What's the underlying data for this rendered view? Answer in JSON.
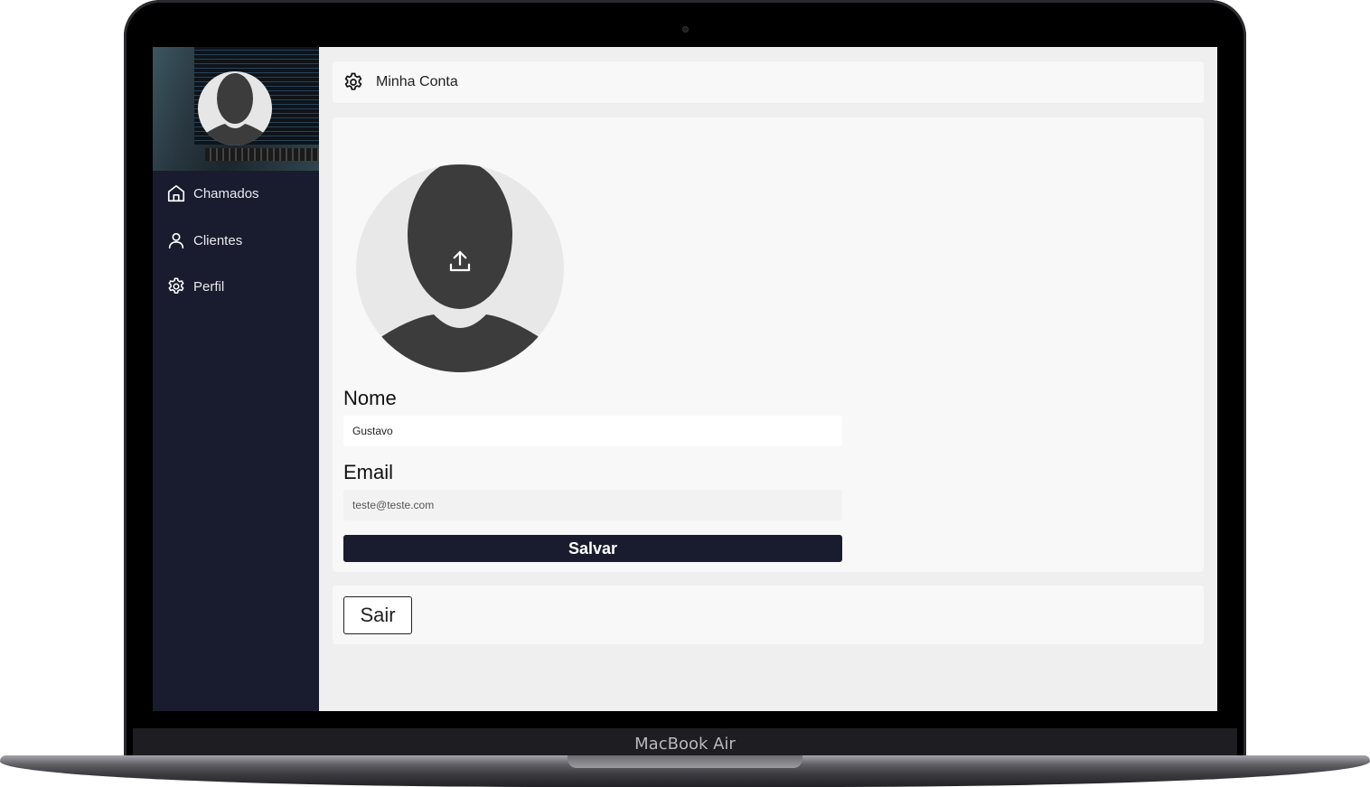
{
  "device": {
    "model": "MacBook Air"
  },
  "sidebar": {
    "items": [
      {
        "label": "Chamados",
        "icon": "home-icon"
      },
      {
        "label": "Clientes",
        "icon": "user-icon"
      },
      {
        "label": "Perfil",
        "icon": "gear-icon"
      }
    ]
  },
  "header": {
    "title": "Minha Conta",
    "icon": "gear-icon"
  },
  "profile_form": {
    "avatar_icon": "upload-icon",
    "name_label": "Nome",
    "name_value": "Gustavo",
    "email_label": "Email",
    "email_value": "teste@teste.com",
    "save_label": "Salvar"
  },
  "logout": {
    "label": "Sair"
  },
  "colors": {
    "sidebar_bg": "#181c2e",
    "accent": "#181c2e",
    "content_bg": "#efefef",
    "card_bg": "#f8f8f8"
  }
}
